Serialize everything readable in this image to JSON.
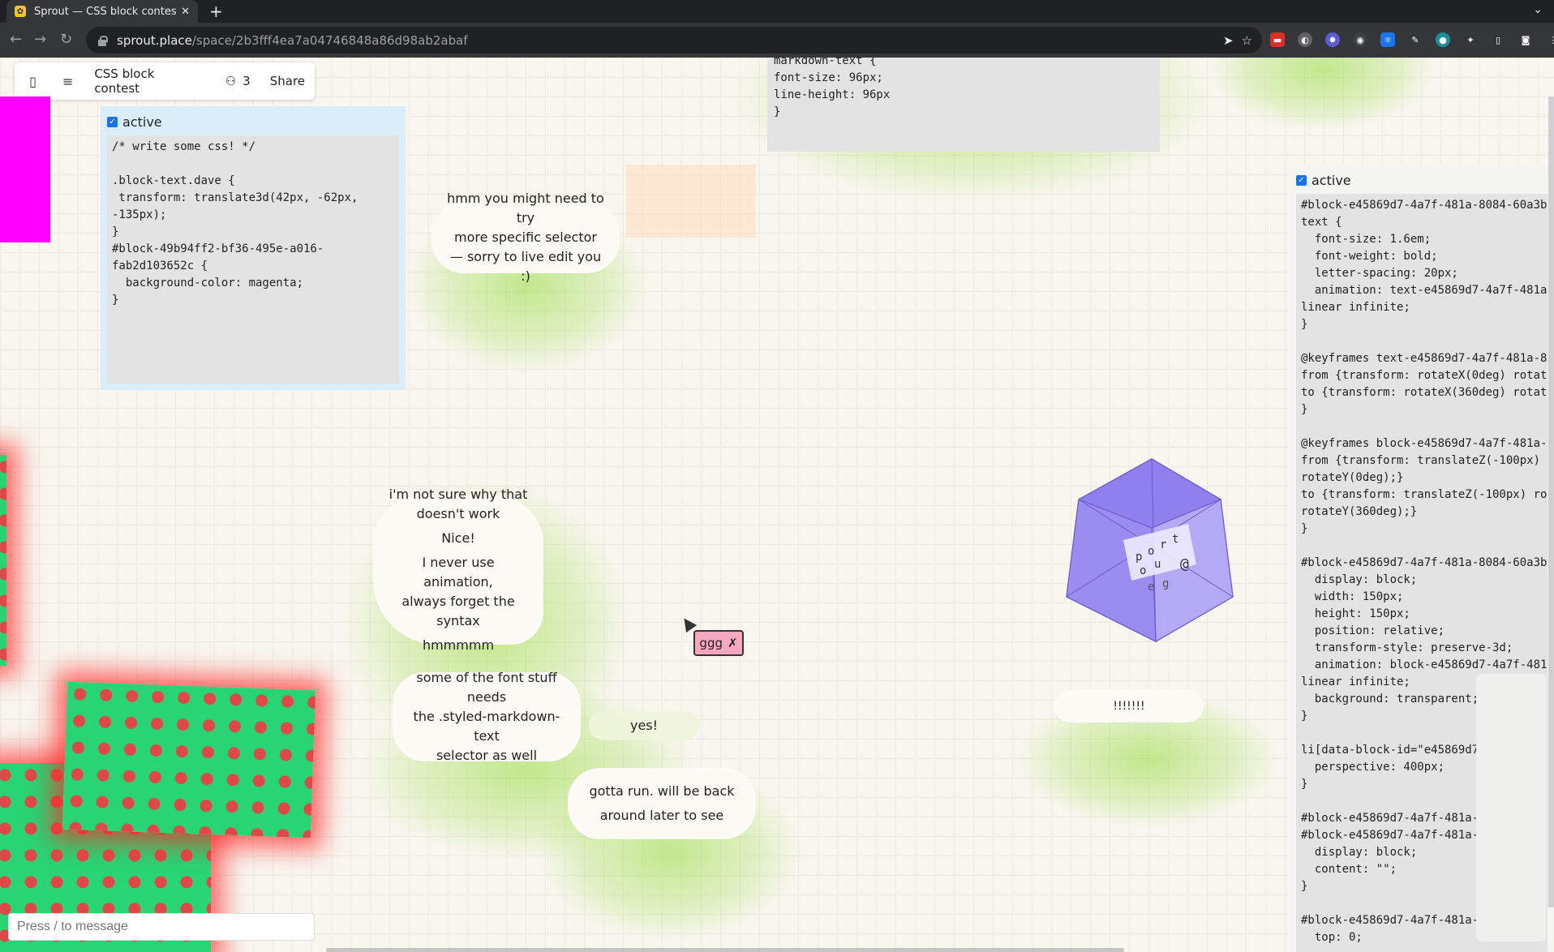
{
  "browser": {
    "tab_title": "Sprout — CSS block contes",
    "tab_favicon": "sprout-favicon",
    "new_tab": "+",
    "url_host": "sprout.place",
    "url_path": "/space/2b3fff4ea7a04746848a86d98ab2abaf"
  },
  "topbar": {
    "title": "CSS block contest",
    "participants": "3",
    "share_label": "Share"
  },
  "left_panel": {
    "label": "active",
    "code": "/* write some css! */\n\n.block-text.dave {\n transform: translate3d(42px, -62px,\n-135px);\n}\n#block-49b94ff2-bf36-495e-a016-\nfab2d103652c {\n  background-color: magenta;\n}"
  },
  "top_panel": {
    "code": "markdown-text {\nfont-size: 96px;\nline-height: 96px\n}"
  },
  "right_panel": {
    "label": "active",
    "code": "#block-e45869d7-4a7f-481a-8084-60a3ba\ntext {\n  font-size: 1.6em;\n  font-weight: bold;\n  letter-spacing: 20px;\n  animation: text-e45869d7-4a7f-481a-\nlinear infinite;\n}\n\n@keyframes text-e45869d7-4a7f-481a-80\nfrom {transform: rotateX(0deg) rotate\nto {transform: rotateX(360deg) rotate\n}\n\n@keyframes block-e45869d7-4a7f-481a-8\nfrom {transform: translateZ(-100px) r\nrotateY(0deg);}\nto {transform: translateZ(-100px) rot\nrotateY(360deg);}\n}\n\n#block-e45869d7-4a7f-481a-8084-60a3ba\n  display: block;\n  width: 150px;\n  height: 150px;\n  position: relative;\n  transform-style: preserve-3d;\n  animation: block-e45869d7-4a7f-481a\nlinear infinite;\n  background: transparent;\n}\n\nli[data-block-id=\"e45869d7\n  perspective: 400px;\n}\n\n#block-e45869d7-4a7f-481a-\n#block-e45869d7-4a7f-481a-\n  display: block;\n  content: \"\";\n}\n\n#block-e45869d7-4a7f-481a-\n  top: 0;"
  },
  "bubbles": {
    "b1": [
      "hmm you might need to try",
      "more specific selector",
      "— sorry to live edit you :)"
    ],
    "b2": [
      "i'm not sure why that",
      "doesn't work"
    ],
    "b3": [
      "Nice!"
    ],
    "b4": [
      "I never use animation,",
      "always forget the syntax"
    ],
    "b5": [
      "hmmmmm"
    ],
    "b6": [
      "some of the font stuff needs",
      "the .styled-markdown-text",
      "selector as well"
    ],
    "b7": [
      "yes!"
    ],
    "b8": [
      "gotta run. will be back",
      "around later to see"
    ],
    "b9": [
      "!!!!!!!"
    ]
  },
  "cube_letters": [
    "p",
    "o",
    "r",
    "t",
    "e",
    "o",
    "u",
    "@",
    "e",
    "g"
  ],
  "cursor_tag": "ggg",
  "message_input": {
    "placeholder": "Press / to message"
  },
  "colors": {
    "accent": "#1a73e8",
    "magenta": "#ff00ff",
    "cube": "#9b8cf0",
    "glow": "#96dc3c"
  }
}
